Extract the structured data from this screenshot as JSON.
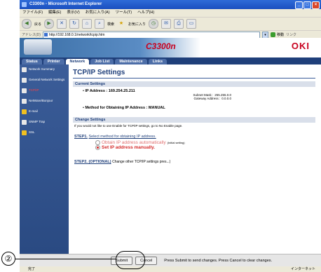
{
  "window": {
    "title": "C3300n - Microsoft Internet Explorer",
    "controls": [
      "_",
      "□",
      "×"
    ]
  },
  "menubar": [
    "ファイル(F)",
    "編集(E)",
    "表示(V)",
    "お気に入り(A)",
    "ツール(T)",
    "ヘルプ(H)"
  ],
  "toolbar": {
    "back_label": "戻る",
    "search_label": "検索",
    "favorites_label": "お気に入り"
  },
  "addressbar": {
    "label": "アドレス(D)",
    "url": "http://192.168.0.1/network/tcpip.htm",
    "go_label": "移動",
    "links_label": "リンク"
  },
  "banner": {
    "model": "C3300n",
    "brand": "OKI"
  },
  "tabs": [
    {
      "label": "Status",
      "active": false
    },
    {
      "label": "Printer",
      "active": false
    },
    {
      "label": "Network",
      "active": true
    },
    {
      "label": "Job List",
      "active": false
    },
    {
      "label": "Maintenance",
      "active": false
    },
    {
      "label": "Links",
      "active": false
    }
  ],
  "sidebar": [
    {
      "label": "Network Summary",
      "icon": "page-icon"
    },
    {
      "label": "General Network Settings",
      "icon": "page-icon"
    },
    {
      "label": "TCP/IP",
      "icon": "page-icon",
      "active": true
    },
    {
      "label": "NetWare/Bonjour",
      "icon": "page-icon"
    },
    {
      "label": "E-mail",
      "icon": "mail-icon"
    },
    {
      "label": "SNMP Trap",
      "icon": "page-icon"
    },
    {
      "label": "SSL",
      "icon": "lock-icon"
    }
  ],
  "main": {
    "title": "TCP/IP Settings",
    "current_header": "Current Settings",
    "ip_label": "IP Address : 169.254.25.211",
    "subnet_label": "Subnet Mask :",
    "subnet_value": "255.255.0.0",
    "gateway_label": "Gateway Address :",
    "gateway_value": "0.0.0.0",
    "method_label": "Method for Obtaining IP Address : MANUAL",
    "change_header": "Change Settings",
    "change_note": "If you would not like to use Enable for TCP/IP settings, go to No Enable page.",
    "step1_head": "STEP1.",
    "step1_text": "Select method for obtaining IP address.",
    "radio_auto": "Obtain IP address automatically",
    "radio_auto_note": "(Initial setting)",
    "radio_manual": "Set IP address manually.",
    "step2_head": "STEP2. (OPTIONAL)",
    "step2_text": "Change other TCP/IP settings pres...)"
  },
  "actions": {
    "submit": "Submit",
    "cancel": "Cancel",
    "hint": "Press Submit to send changes. Press Cancel to clear changes."
  },
  "status": {
    "left": "完了",
    "zone": "インターネット"
  },
  "callout": {
    "number": "②"
  },
  "colors": {
    "accent": "#1f3f7a",
    "brand": "#c8001e",
    "selected": "#d42a2a"
  }
}
